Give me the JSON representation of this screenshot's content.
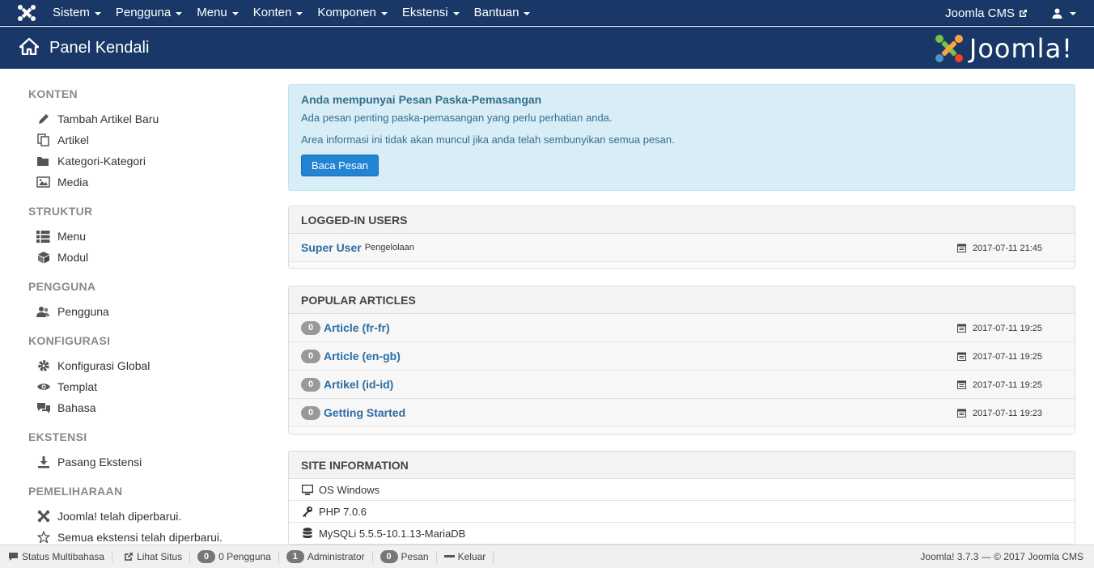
{
  "topnav": {
    "items": [
      "Sistem",
      "Pengguna",
      "Menu",
      "Konten",
      "Komponen",
      "Ekstensi",
      "Bantuan"
    ],
    "site_name": "Joomla CMS"
  },
  "header": {
    "title": "Panel Kendali",
    "brand": "Joomla!"
  },
  "sidebar": {
    "sections": [
      {
        "title": "KONTEN",
        "items": [
          {
            "label": "Tambah Artikel Baru",
            "icon": "pencil-icon"
          },
          {
            "label": "Artikel",
            "icon": "copy-icon"
          },
          {
            "label": "Kategori-Kategori",
            "icon": "folder-icon"
          },
          {
            "label": "Media",
            "icon": "image-icon"
          }
        ]
      },
      {
        "title": "STRUKTUR",
        "items": [
          {
            "label": "Menu",
            "icon": "list-icon"
          },
          {
            "label": "Modul",
            "icon": "cube-icon"
          }
        ]
      },
      {
        "title": "PENGGUNA",
        "items": [
          {
            "label": "Pengguna",
            "icon": "users-icon"
          }
        ]
      },
      {
        "title": "KONFIGURASI",
        "items": [
          {
            "label": "Konfigurasi Global",
            "icon": "cog-icon"
          },
          {
            "label": "Templat",
            "icon": "eye-icon"
          },
          {
            "label": "Bahasa",
            "icon": "comments-icon"
          }
        ]
      },
      {
        "title": "EKSTENSI",
        "items": [
          {
            "label": "Pasang Ekstensi",
            "icon": "download-icon"
          }
        ]
      },
      {
        "title": "PEMELIHARAAN",
        "items": [
          {
            "label": "Joomla! telah diperbarui.",
            "icon": "joomla-icon"
          },
          {
            "label": "Semua ekstensi telah diperbarui.",
            "icon": "star-icon"
          }
        ]
      }
    ]
  },
  "alert": {
    "title": "Anda mempunyai Pesan Paska-Pemasangan",
    "line1": "Ada pesan penting paska-pemasangan yang perlu perhatian anda.",
    "line2": "Area informasi ini tidak akan muncul jika anda telah sembunyikan semua pesan.",
    "button": "Baca Pesan"
  },
  "logged_in": {
    "title": "LOGGED-IN USERS",
    "rows": [
      {
        "name": "Super User",
        "role": "Pengelolaan",
        "date": "2017-07-11 21:45"
      }
    ]
  },
  "popular": {
    "title": "POPULAR ARTICLES",
    "rows": [
      {
        "hits": "0",
        "title": "Article (fr-fr)",
        "date": "2017-07-11 19:25"
      },
      {
        "hits": "0",
        "title": "Article (en-gb)",
        "date": "2017-07-11 19:25"
      },
      {
        "hits": "0",
        "title": "Artikel (id-id)",
        "date": "2017-07-11 19:25"
      },
      {
        "hits": "0",
        "title": "Getting Started",
        "date": "2017-07-11 19:23"
      }
    ]
  },
  "site_info": {
    "title": "SITE INFORMATION",
    "rows": [
      {
        "label": "OS Windows",
        "icon": "monitor-icon"
      },
      {
        "label": "PHP 7.0.6",
        "icon": "key-icon"
      },
      {
        "label": "MySQLi 5.5.5-10.1.13-MariaDB",
        "icon": "database-icon"
      }
    ]
  },
  "statusbar": {
    "multilang": "Status Multibahasa",
    "view_site": "Lihat Situs",
    "users_count": "0",
    "users_label": "0 Pengguna",
    "admin_count": "1",
    "admin_label": "Administrator",
    "msg_count": "0",
    "msg_label": "Pesan",
    "logout": "Keluar",
    "copyright": "Joomla! 3.7.3 — © 2017 Joomla CMS"
  },
  "colors": {
    "navbar": "#1a3867",
    "link": "#2c6ca3",
    "alert_bg": "#d9edf7",
    "button": "#2384d3"
  }
}
